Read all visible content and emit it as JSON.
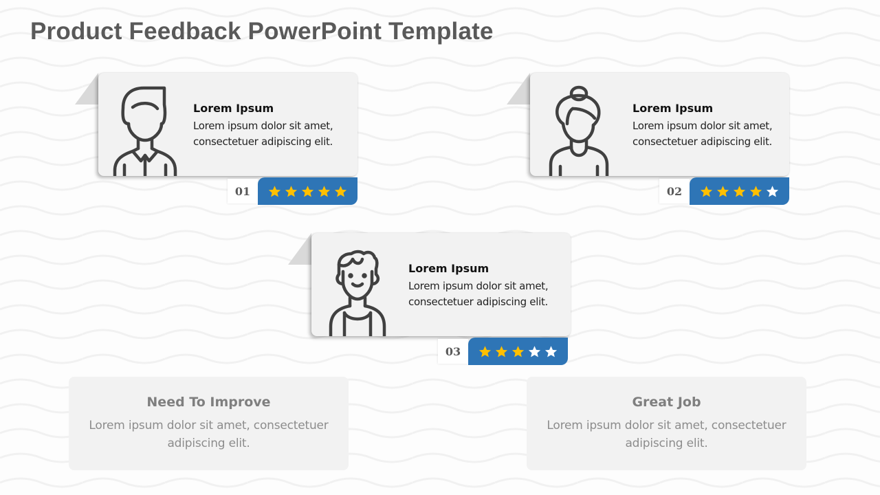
{
  "title": "Product Feedback PowerPoint Template",
  "colors": {
    "star_filled": "#ffc000",
    "star_empty": "#ffffff",
    "rating_bar": "#2e75b6",
    "icon_stroke": "#404040"
  },
  "reviews": [
    {
      "number": "01",
      "avatar_icon": "man-with-collar-icon",
      "heading": "Lorem Ipsum",
      "body_line1": "Lorem ipsum dolor sit amet,",
      "body_line2": "consectetuer adipiscing elit.",
      "rating": 5,
      "max_rating": 5
    },
    {
      "number": "02",
      "avatar_icon": "woman-with-bun-icon",
      "heading": "Lorem Ipsum",
      "body_line1": "Lorem ipsum dolor sit amet,",
      "body_line2": "consectetuer adipiscing elit.",
      "rating": 4,
      "max_rating": 5
    },
    {
      "number": "03",
      "avatar_icon": "young-man-smiling-icon",
      "heading": "Lorem Ipsum",
      "body_line1": "Lorem ipsum dolor sit amet,",
      "body_line2": "consectetuer adipiscing elit.",
      "rating": 3,
      "max_rating": 5
    }
  ],
  "summaries": [
    {
      "title": "Need To Improve",
      "body": "Lorem ipsum dolor sit amet, consectetuer adipiscing elit."
    },
    {
      "title": "Great Job",
      "body": "Lorem ipsum dolor sit amet, consectetuer adipiscing elit."
    }
  ]
}
